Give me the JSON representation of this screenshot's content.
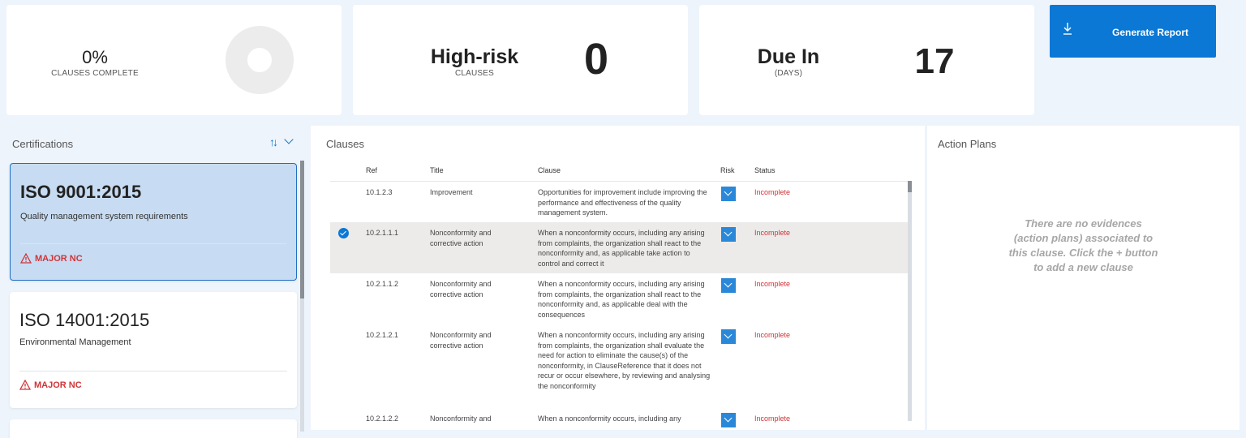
{
  "stats": {
    "complete": {
      "value": "0%",
      "label": "CLAUSES COMPLETE",
      "fraction": 0
    },
    "high_risk": {
      "title": "High-risk",
      "label": "CLAUSES",
      "value": "0"
    },
    "due": {
      "title": "Due In",
      "label": "(DAYS)",
      "value": "17"
    }
  },
  "generate_button": {
    "label": "Generate Report",
    "icon": "download-icon"
  },
  "certifications": {
    "title": "Certifications",
    "sort_icon": "sort-icon",
    "items": [
      {
        "name": "ISO 9001:2015",
        "description": "Quality management system requirements",
        "badge": "MAJOR NC",
        "selected": true
      },
      {
        "name": "ISO 14001:2015",
        "description": "Environmental Management",
        "badge": "MAJOR NC",
        "selected": false
      }
    ]
  },
  "clauses": {
    "title": "Clauses",
    "headers": {
      "ref": "Ref",
      "title": "Title",
      "clause": "Clause",
      "risk": "Risk",
      "status": "Status"
    },
    "rows": [
      {
        "ref": "10.1.2.3",
        "title": "Improvement",
        "clause": "Opportunities for improvement include improving the performance and effectiveness of the quality management system.",
        "status": "Incomplete",
        "selected": false
      },
      {
        "ref": "10.2.1.1.1",
        "title": "Nonconformity and corrective action",
        "clause": "When a nonconformity occurs, including any arising from complaints, the organization shall react to the nonconformity and, as applicable take action to control and correct it",
        "status": "Incomplete",
        "selected": true
      },
      {
        "ref": "10.2.1.1.2",
        "title": "Nonconformity and corrective action",
        "clause": "When a nonconformity occurs, including any arising from complaints, the organization shall react to the nonconformity and, as applicable deal with the consequences",
        "status": "Incomplete",
        "selected": false
      },
      {
        "ref": "10.2.1.2.1",
        "title": "Nonconformity and corrective action",
        "clause": "When a nonconformity occurs, including any arising from complaints, the organization shall evaluate the need for action to eliminate the cause(s) of the nonconformity, in ClauseReference that it does not recur or occur elsewhere, by reviewing and analysing the nonconformity",
        "status": "Incomplete",
        "selected": false
      },
      {
        "ref": "10.2.1.2.2",
        "title": "Nonconformity and",
        "clause": "When a nonconformity occurs, including any",
        "status": "Incomplete",
        "selected": false
      }
    ]
  },
  "action_plans": {
    "title": "Action Plans",
    "empty_message": "There are no evidences (action plans) associated to this clause. Click the + button to add a new clause"
  },
  "colors": {
    "accent": "#0a78d4",
    "danger": "#d13438",
    "selected_card": "#c7dcf2"
  }
}
